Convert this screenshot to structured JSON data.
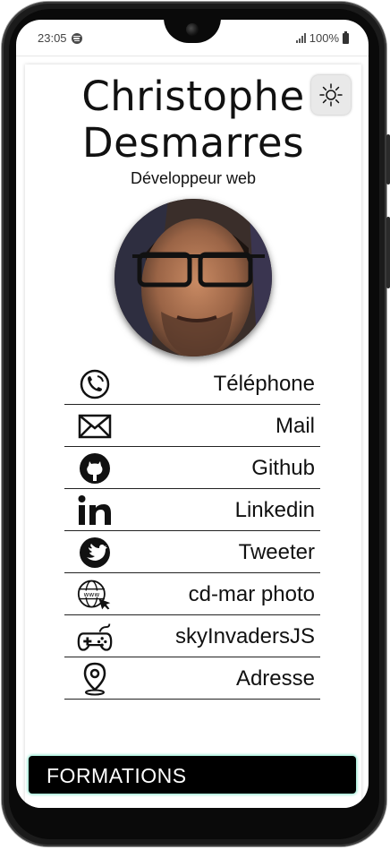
{
  "status": {
    "time": "23:05",
    "battery": "100%",
    "icons": [
      "spotify-icon",
      "signal-icon",
      "battery-icon"
    ]
  },
  "profile": {
    "name_line1": "Christophe",
    "name_line2": "Desmarres",
    "role": "Développeur web",
    "theme_toggle_icon": "sun-icon"
  },
  "links": [
    {
      "label": "Téléphone",
      "icon": "phone-icon"
    },
    {
      "label": "Mail",
      "icon": "mail-icon"
    },
    {
      "label": "Github",
      "icon": "github-icon"
    },
    {
      "label": "Linkedin",
      "icon": "linkedin-icon"
    },
    {
      "label": "Tweeter",
      "icon": "twitter-icon"
    },
    {
      "label": "cd-mar photo",
      "icon": "globe-www-icon"
    },
    {
      "label": "skyInvadersJS",
      "icon": "gamepad-icon"
    },
    {
      "label": "Adresse",
      "icon": "location-pin-icon"
    }
  ],
  "formations": {
    "label": "FORMATIONS"
  },
  "colors": {
    "text": "#111111",
    "accent_glow": "#7fe3c8",
    "formations_bg": "#000000"
  }
}
